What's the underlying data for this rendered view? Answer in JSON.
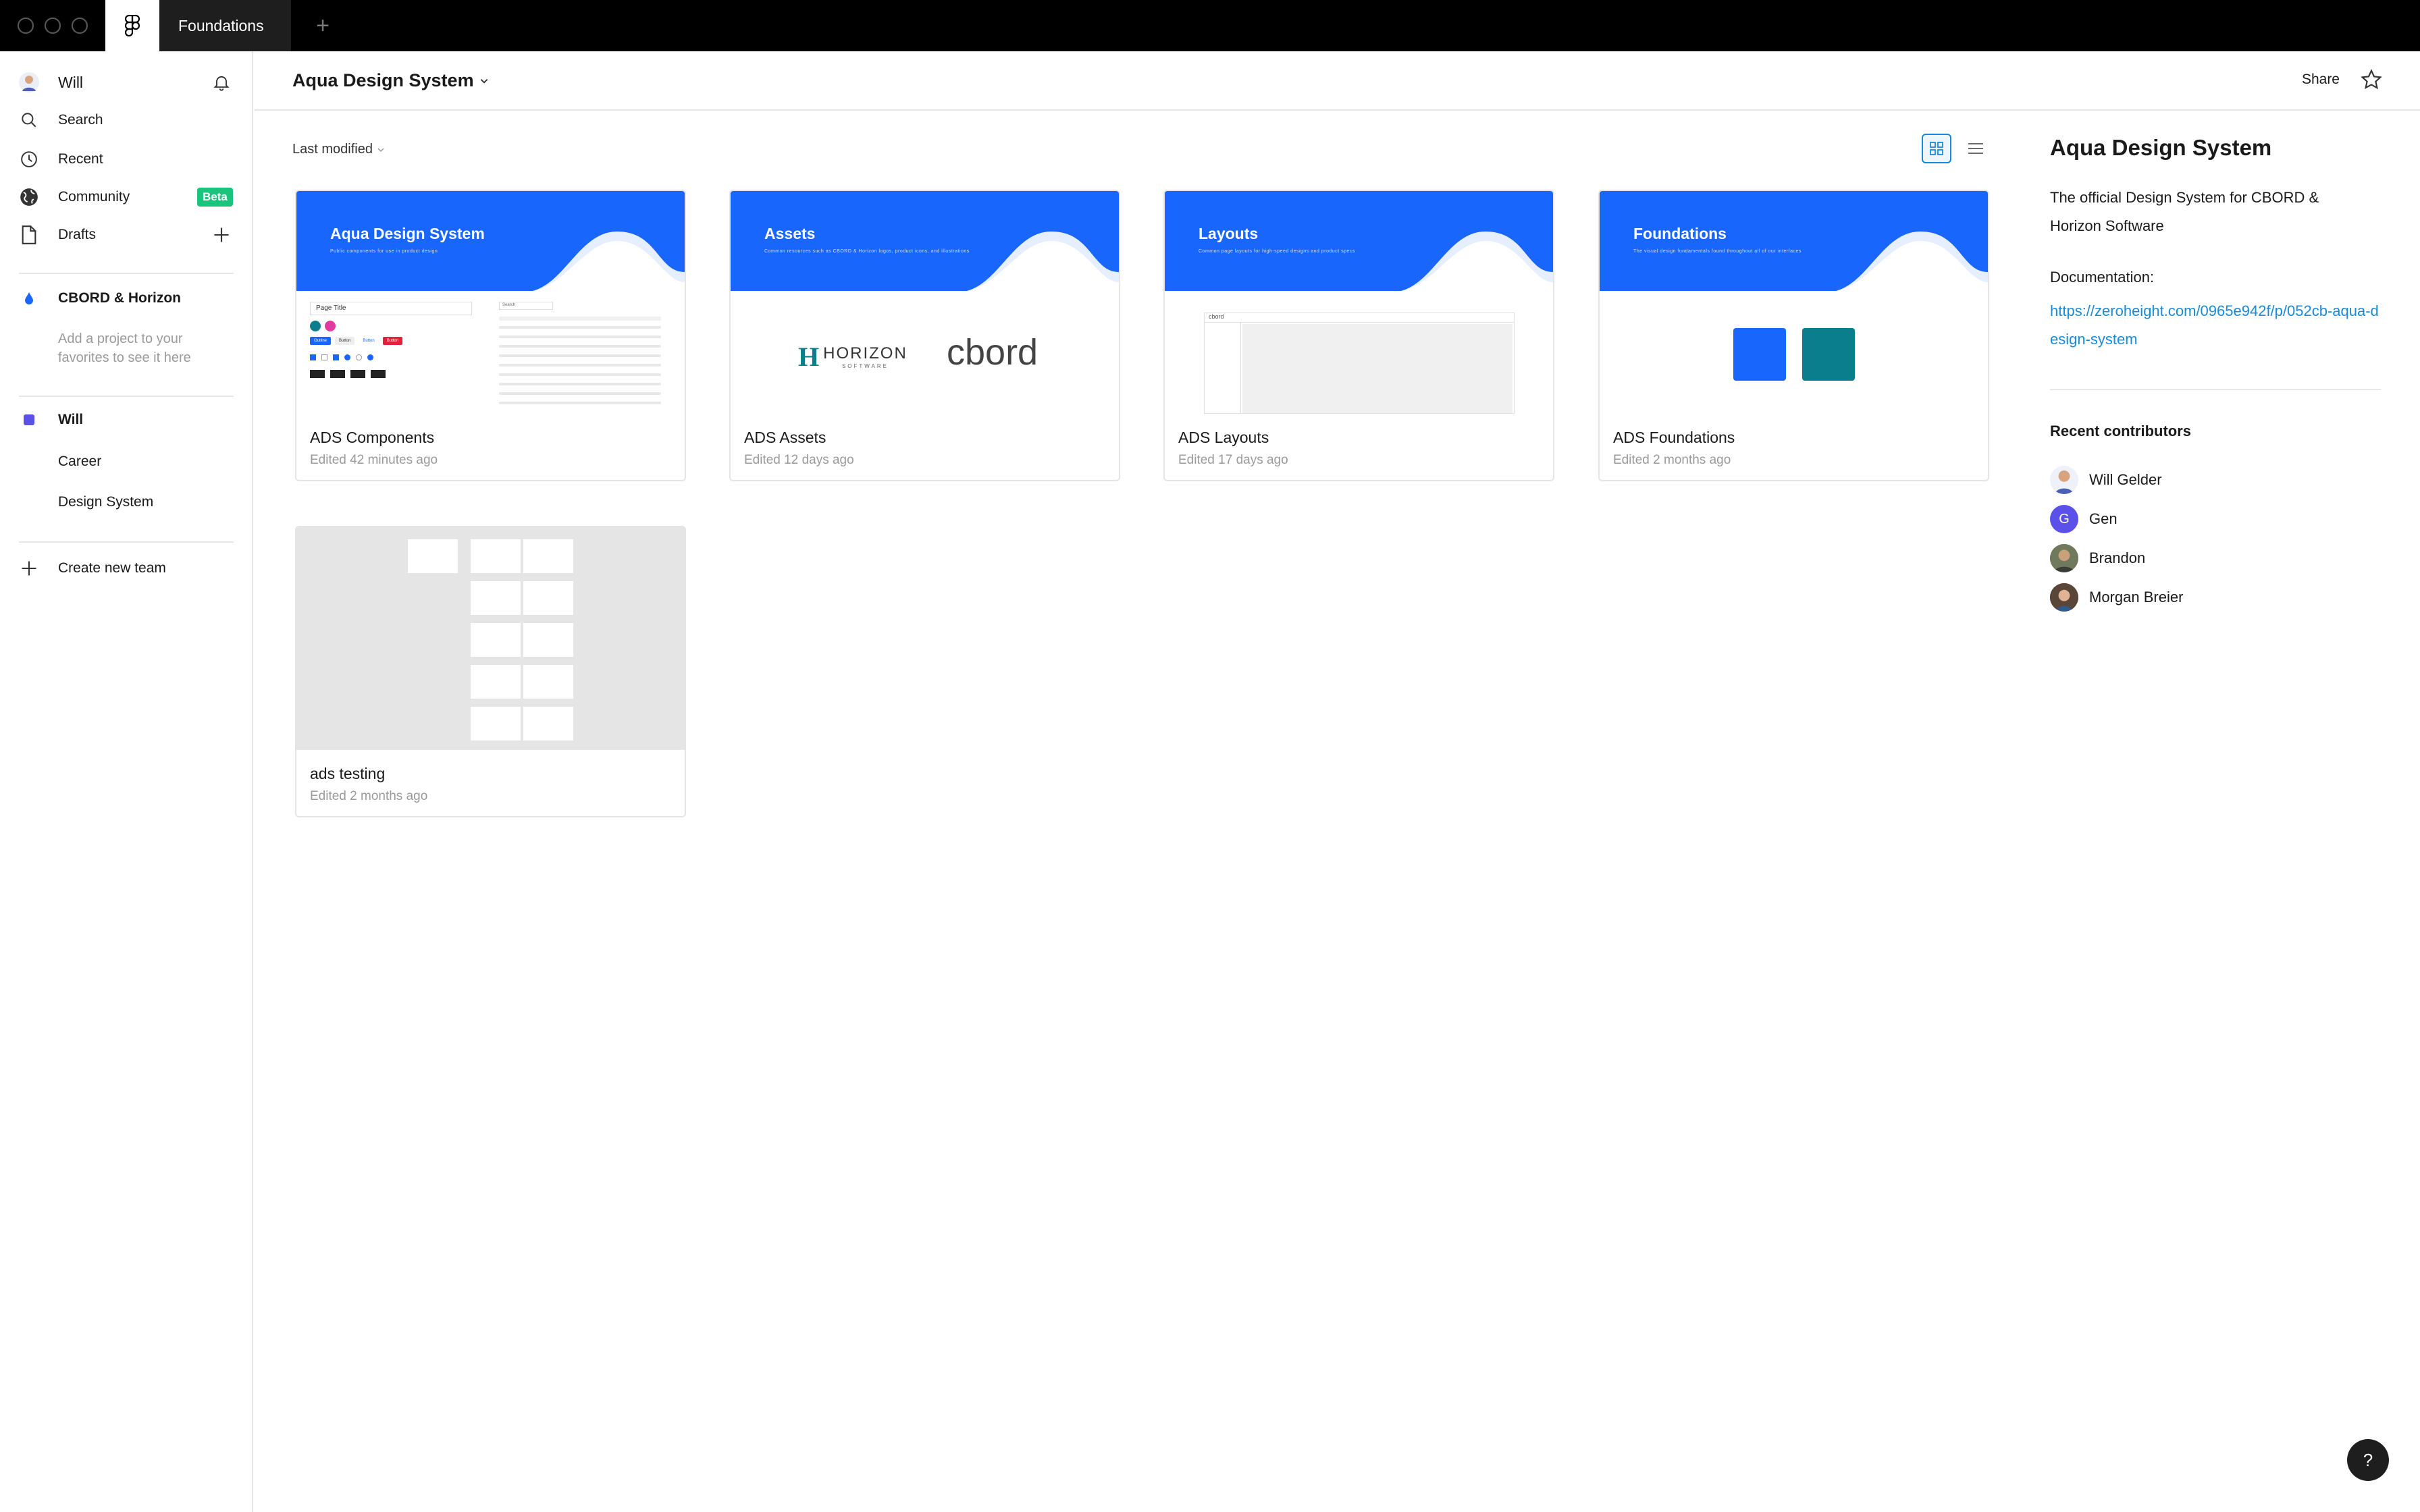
{
  "titlebar": {
    "file_tab": "Foundations",
    "new_tab": "+"
  },
  "sidebar": {
    "user": "Will",
    "nav": [
      {
        "label": "Search",
        "icon": "search-icon"
      },
      {
        "label": "Recent",
        "icon": "clock-icon"
      },
      {
        "label": "Community",
        "icon": "globe-icon",
        "badge": "Beta"
      },
      {
        "label": "Drafts",
        "icon": "file-icon"
      }
    ],
    "team1": {
      "name": "CBORD & Horizon",
      "hint": "Add a project to your favorites to see it here"
    },
    "team2": {
      "name": "Will",
      "projects": [
        "Career",
        "Design System"
      ]
    },
    "create_team": "Create new team"
  },
  "header": {
    "title": "Aqua Design System",
    "share": "Share"
  },
  "sort": {
    "label": "Last modified"
  },
  "cards": [
    {
      "banner": "Aqua Design System",
      "banner_sub": "Public components for use in product design",
      "title": "ADS Components",
      "edited": "Edited 42 minutes ago",
      "mock_page_title": "Page Title",
      "mock_search": "Search",
      "mock_btn_labels": [
        "Outline",
        "Button",
        "Button",
        "Button"
      ]
    },
    {
      "banner": "Assets",
      "banner_sub": "Common resources such as CBORD & Horizon logos, product icons, and illustrations",
      "title": "ADS Assets",
      "edited": "Edited 12 days ago",
      "logo_left": "HORIZON",
      "logo_left_sub": "SOFTWARE",
      "logo_right": "cbord"
    },
    {
      "banner": "Layouts",
      "banner_sub": "Common page layouts for high-speed designs and product specs",
      "title": "ADS Layouts",
      "edited": "Edited 17 days ago",
      "mock_logo": "cbord"
    },
    {
      "banner": "Foundations",
      "banner_sub": "The visual design fundamentals found throughout all of our interfaces",
      "title": "ADS Foundations",
      "edited": "Edited 2 months ago"
    },
    {
      "title": "ads testing",
      "edited": "Edited 2 months ago"
    }
  ],
  "info": {
    "title": "Aqua Design System",
    "description": "The official Design System for CBORD & Horizon Software",
    "doc_label": "Documentation:",
    "doc_link": "https://zeroheight.com/0965e942f/p/052cb-aqua-design-system",
    "recent_contributors_label": "Recent contributors",
    "contributors": [
      {
        "name": "Will Gelder",
        "avatar": "photo"
      },
      {
        "name": "Gen",
        "avatar": "initial",
        "initial": "G",
        "color": "#5b51e8"
      },
      {
        "name": "Brandon",
        "avatar": "photo"
      },
      {
        "name": "Morgan Breier",
        "avatar": "photo"
      }
    ]
  },
  "colors": {
    "accent": "#1866fb",
    "teal": "#0a7e8c",
    "badge": "#1bc47d",
    "link": "#1a8ad8"
  },
  "help": "?"
}
